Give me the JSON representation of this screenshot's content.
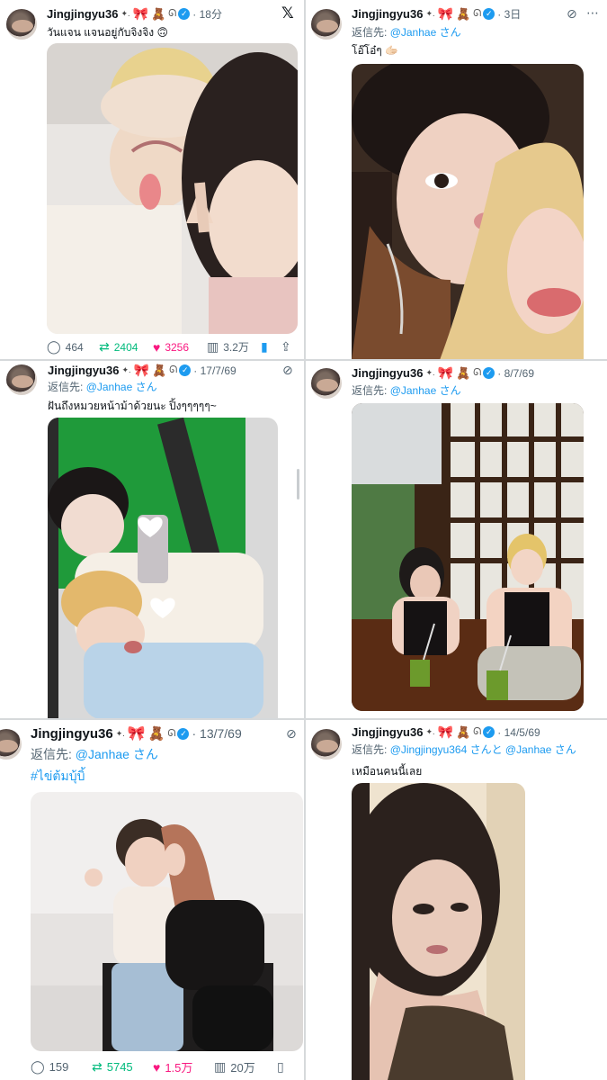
{
  "posts": [
    {
      "username": "Jingjingyu36",
      "time": "18分",
      "text": "วันแจน แจนอยู่กับจิงจิง 🙃",
      "replies": "464",
      "reposts": "2404",
      "likes": "3256",
      "views": "3.2万"
    },
    {
      "username": "Jingjingyu36",
      "time": "3日",
      "reply_label": "返信先:",
      "reply_handle": "@Janhae さん",
      "text": "โอ๊โอ๋ๆ 🫱🏻"
    },
    {
      "username": "Jingjingyu36",
      "time": "17/7/69",
      "reply_label": "返信先:",
      "reply_handle": "@Janhae さん",
      "text": "ฝันถึงหมวยหน้าม้าด้วยนะ ปิ้งๆๆๆๆๆ~"
    },
    {
      "username": "Jingjingyu36",
      "time": "8/7/69",
      "reply_label": "返信先:",
      "reply_handle": "@Janhae さん"
    },
    {
      "username": "Jingjingyu36",
      "time": "13/7/69",
      "reply_label": "返信先:",
      "reply_handle": "@Janhae さん",
      "hashtag": "#ไข่ต้มบุ้บิ้",
      "replies": "159",
      "reposts": "5745",
      "likes": "1.5万",
      "views": "20万"
    },
    {
      "username": "Jingjingyu36",
      "time": "14/5/69",
      "reply_label": "返信先:",
      "reply_handle": "@Jingjingyu364 さんと @Janhae さん",
      "text": "เหมือนคนนี้เลย"
    }
  ],
  "icons": {
    "verified": "✓",
    "x_logo": "𝕏",
    "grok": "⊘",
    "more": "⋯",
    "reply": "◯",
    "repost": "⇄",
    "like": "♥",
    "views": "📊",
    "bookmark": "🔖",
    "share": "⇪"
  },
  "colors": {
    "link": "#1d9bf0",
    "repost": "#00ba7c",
    "like": "#f91880",
    "muted": "#536471"
  }
}
